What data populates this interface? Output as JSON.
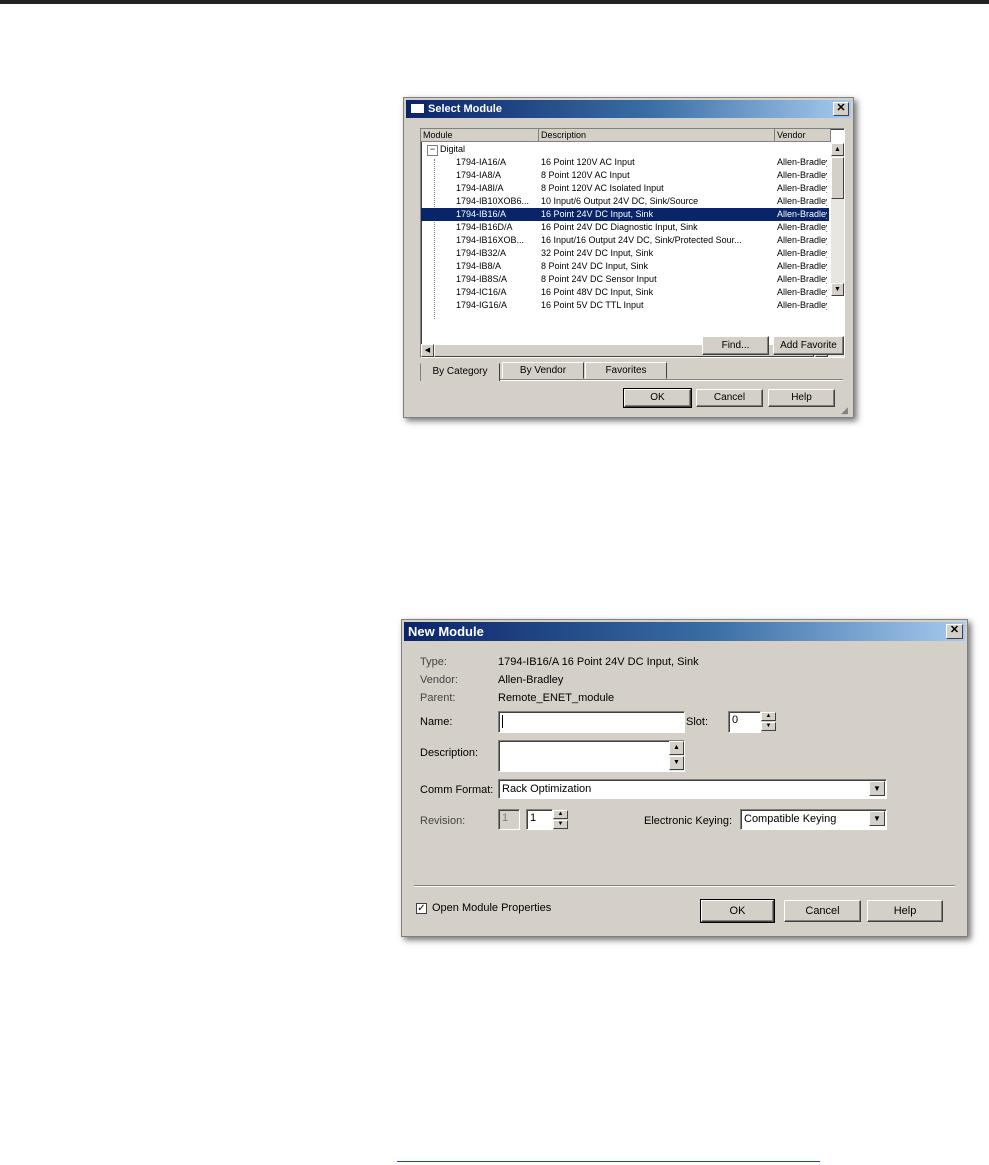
{
  "select_module": {
    "title": "Select Module",
    "columns": [
      "Module",
      "Description",
      "Vendor"
    ],
    "category": "Digital",
    "rows": [
      {
        "module": "1794-IA16/A",
        "description": "16 Point 120V AC Input",
        "vendor": "Allen-Bradley"
      },
      {
        "module": "1794-IA8/A",
        "description": "8 Point 120V AC Input",
        "vendor": "Allen-Bradley"
      },
      {
        "module": "1794-IA8I/A",
        "description": "8 Point 120V AC Isolated Input",
        "vendor": "Allen-Bradley"
      },
      {
        "module": "1794-IB10XOB6...",
        "description": "10 Input/6 Output 24V DC, Sink/Source",
        "vendor": "Allen-Bradley"
      },
      {
        "module": "1794-IB16/A",
        "description": "16 Point 24V DC Input, Sink",
        "vendor": "Allen-Bradley"
      },
      {
        "module": "1794-IB16D/A",
        "description": "16 Point 24V DC Diagnostic Input, Sink",
        "vendor": "Allen-Bradley"
      },
      {
        "module": "1794-IB16XOB...",
        "description": "16 Input/16 Output 24V DC, Sink/Protected Sour...",
        "vendor": "Allen-Bradley"
      },
      {
        "module": "1794-IB32/A",
        "description": "32 Point 24V DC Input, Sink",
        "vendor": "Allen-Bradley"
      },
      {
        "module": "1794-IB8/A",
        "description": "8 Point 24V DC Input, Sink",
        "vendor": "Allen-Bradley"
      },
      {
        "module": "1794-IB8S/A",
        "description": "8 Point 24V DC Sensor Input",
        "vendor": "Allen-Bradley"
      },
      {
        "module": "1794-IC16/A",
        "description": "16 Point 48V DC Input, Sink",
        "vendor": "Allen-Bradley"
      },
      {
        "module": "1794-IG16/A",
        "description": "16 Point 5V DC TTL Input",
        "vendor": "Allen-Bradley"
      }
    ],
    "find_label": "Find...",
    "add_favorite_label": "Add Favorite",
    "tabs": [
      "By Category",
      "By Vendor",
      "Favorites"
    ],
    "ok_label": "OK",
    "cancel_label": "Cancel",
    "help_label": "Help"
  },
  "new_module": {
    "title": "New Module",
    "type_label": "Type:",
    "type_value": "1794-IB16/A 16 Point 24V DC Input, Sink",
    "vendor_label": "Vendor:",
    "vendor_value": "Allen-Bradley",
    "parent_label": "Parent:",
    "parent_value": "Remote_ENET_module",
    "name_label": "Name:",
    "name_value": "",
    "slot_label": "Slot:",
    "slot_value": "0",
    "description_label": "Description:",
    "description_value": "",
    "comm_format_label": "Comm Format:",
    "comm_format_value": "Rack Optimization",
    "revision_label": "Revision:",
    "revision_major": "1",
    "revision_minor": "1",
    "keying_label": "Electronic Keying:",
    "keying_value": "Compatible Keying",
    "open_properties_label": "Open Module Properties",
    "ok_label": "OK",
    "cancel_label": "Cancel",
    "help_label": "Help"
  }
}
